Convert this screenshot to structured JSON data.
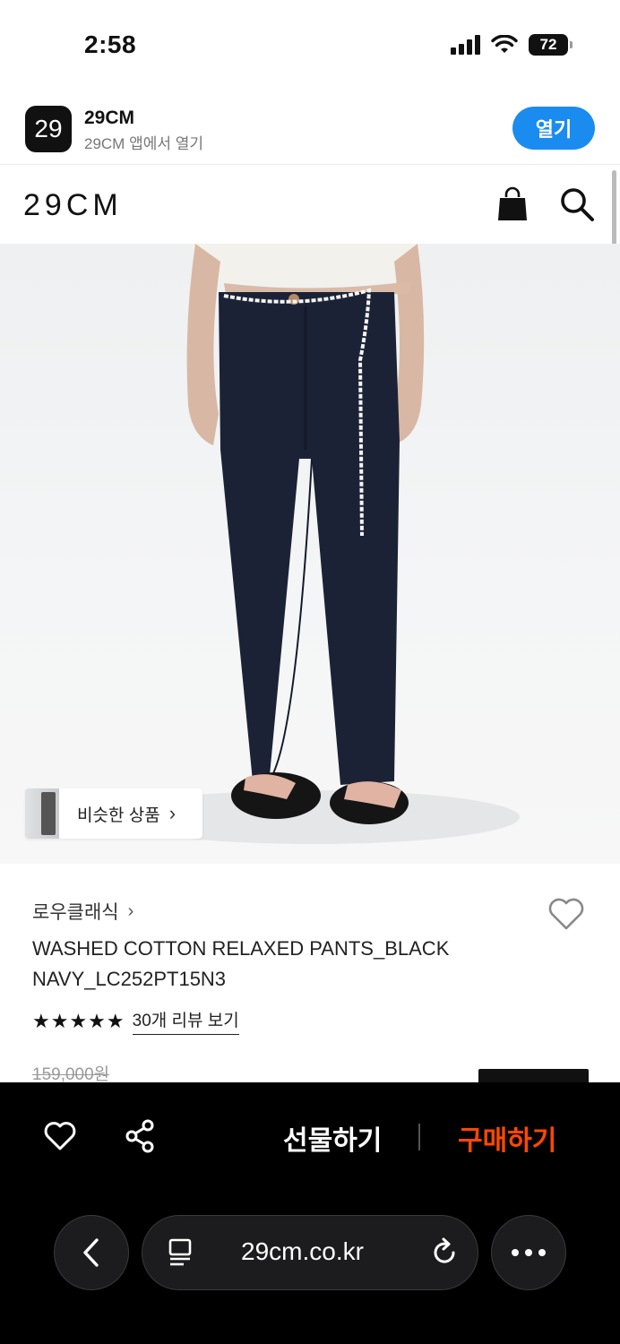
{
  "status_bar": {
    "time": "2:58",
    "battery": "72"
  },
  "app_banner": {
    "icon_text": "29",
    "app_name": "29CM",
    "subtitle": "29CM 앱에서 열기",
    "open_label": "열기"
  },
  "header": {
    "logo": "29CM"
  },
  "hero": {
    "similar_label": "비슷한 상품"
  },
  "product": {
    "brand": "로우클래식",
    "name": "WASHED COTTON RELAXED PANTS_BLACK NAVY_LC252PT15N3",
    "stars": "★★★★★",
    "rating": 5,
    "review_link": "30개 리뷰 보기",
    "original_price": "159,000원"
  },
  "bottom_actions": {
    "gift_label": "선물하기",
    "buy_label": "구매하기",
    "buy_color": "#ff4800"
  },
  "browser": {
    "url": "29cm.co.kr"
  },
  "colors": {
    "accent_blue": "#1a8cf0",
    "pants": "#1c2236",
    "background_dark": "#000000"
  },
  "icons": {
    "bag": "shopping-bag-icon",
    "search": "search-icon",
    "wish": "heart-outline-icon",
    "share": "share-icon",
    "back": "chevron-left-icon",
    "reader": "reader-mode-icon",
    "reload": "reload-icon",
    "more": "ellipsis-icon"
  }
}
